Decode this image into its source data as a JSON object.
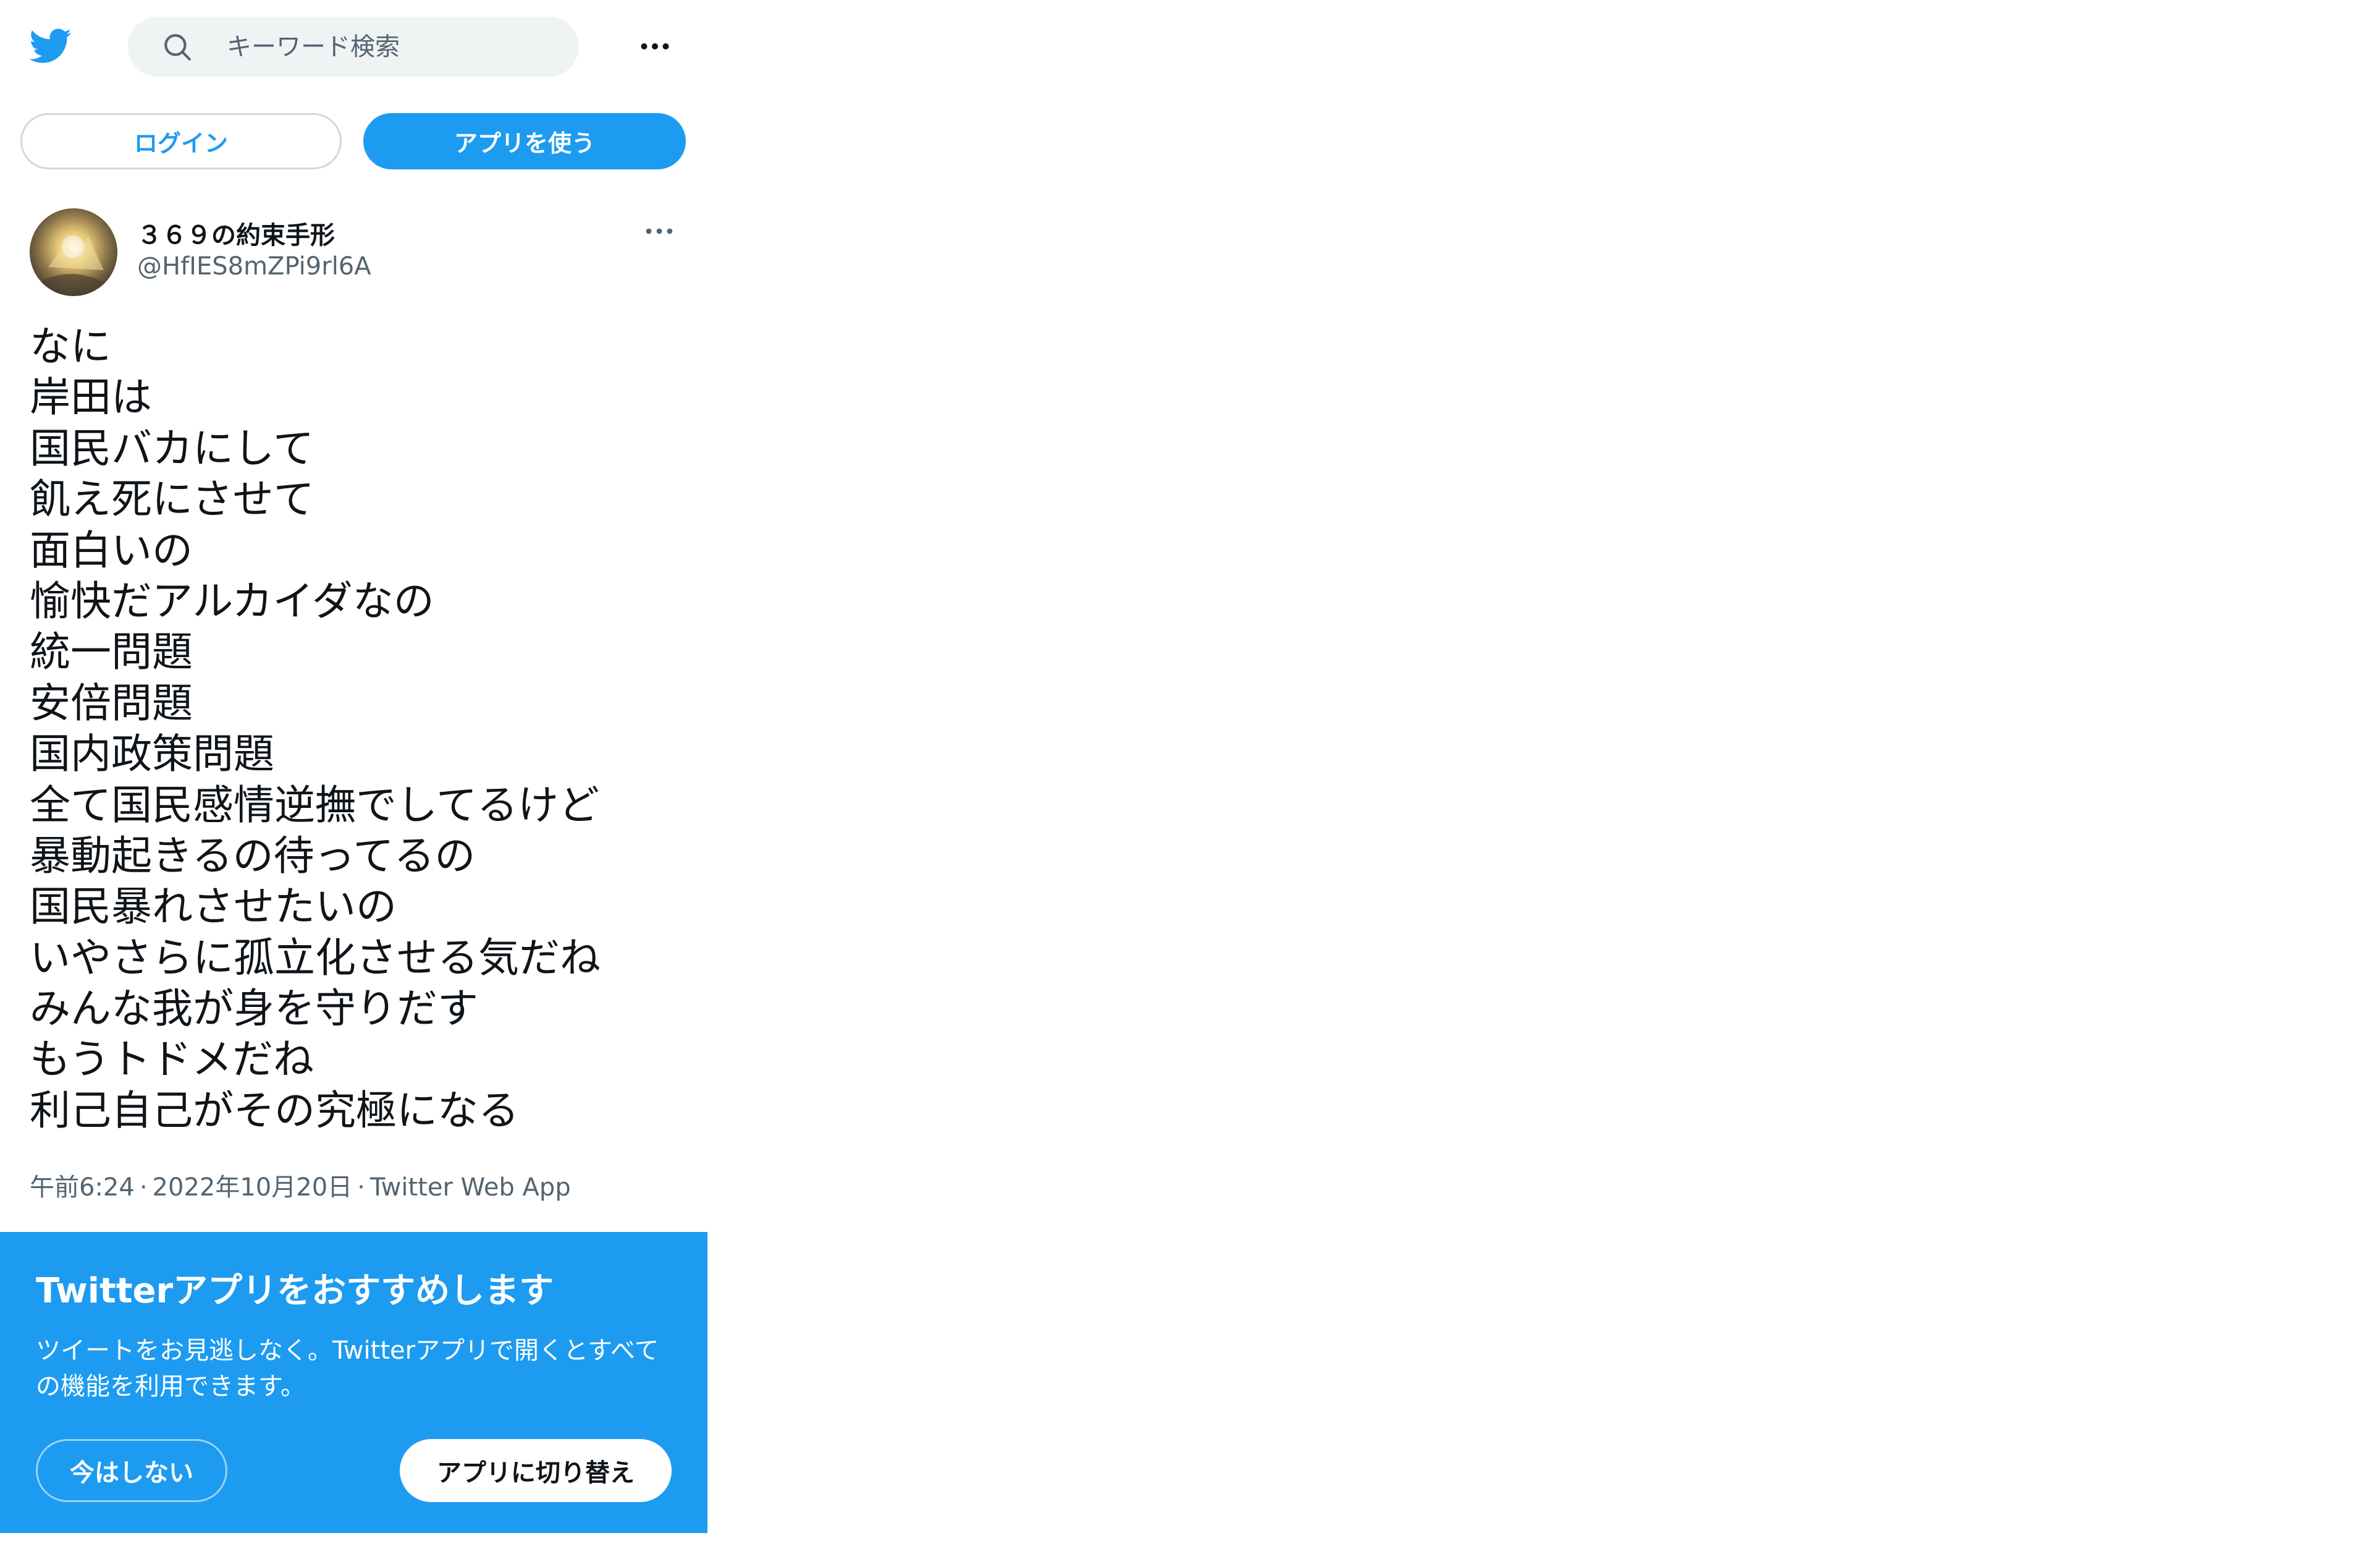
{
  "colors": {
    "brand": "#1d9bf0",
    "text_primary": "#0f1419",
    "text_secondary": "#536471",
    "search_bg": "#eff3f4",
    "border": "#cfd9de"
  },
  "header": {
    "logo_icon": "twitter-bird-icon",
    "search_icon": "search-icon",
    "search_placeholder": "キーワード検索",
    "more_icon": "more-horizontal-icon"
  },
  "auth": {
    "login_label": "ログイン",
    "use_app_label": "アプリを使う"
  },
  "tweet": {
    "display_name": "３６９の約束手形",
    "handle": "@HfIES8mZPi9rl6A",
    "more_icon": "more-horizontal-icon",
    "lines": [
      "なに",
      "岸田は",
      "国民バカにして",
      "飢え死にさせて",
      "面白いの",
      "愉快だアルカイダなの",
      "統一問題",
      "安倍問題",
      "国内政策問題",
      "全て国民感情逆撫でしてるけど",
      "暴動起きるの待ってるの",
      "国民暴れさせたいの",
      "いやさらに孤立化させる気だね",
      "みんな我が身を守りだす",
      "もうトドメだね",
      "利己自己がその究極になる"
    ],
    "time": "午前6:24",
    "separator": "·",
    "date": "2022年10月20日",
    "source": "Twitter Web App"
  },
  "promo": {
    "title": "Twitterアプリをおすすめします",
    "body": "ツイートをお見逃しなく。Twitterアプリで開くとすべての機能を利用できます。",
    "not_now_label": "今はしない",
    "switch_label": "アプリに切り替え"
  }
}
